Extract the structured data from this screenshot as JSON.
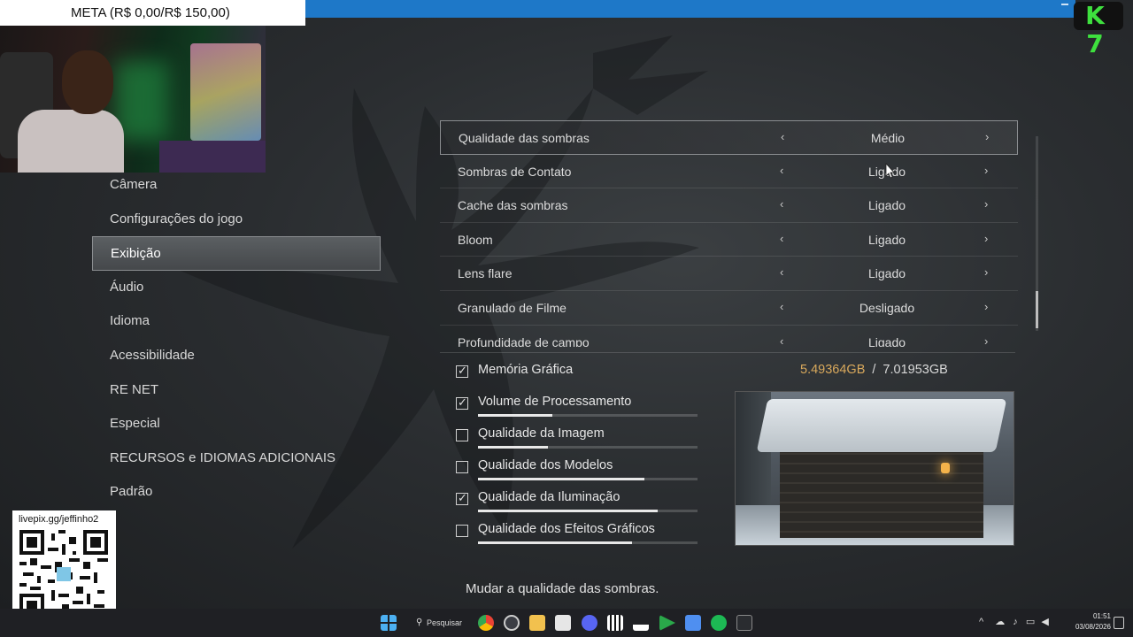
{
  "overlay": {
    "goal_banner": "META (R$ 0,00/R$ 150,00)",
    "qr_url": "livepix.gg/jeffinho2",
    "channel_logo": "K 7"
  },
  "menu": {
    "items": [
      {
        "label": "Câmera",
        "active": false
      },
      {
        "label": "Configurações do jogo",
        "active": false
      },
      {
        "label": "Exibição",
        "active": true
      },
      {
        "label": "Áudio",
        "active": false
      },
      {
        "label": "Idioma",
        "active": false
      },
      {
        "label": "Acessibilidade",
        "active": false
      },
      {
        "label": "RE NET",
        "active": false
      },
      {
        "label": "Especial",
        "active": false
      },
      {
        "label": "RECURSOS e IDIOMAS ADICIONAIS",
        "active": false
      },
      {
        "label": "Padrão",
        "active": false
      }
    ]
  },
  "settings": {
    "rows": [
      {
        "label": "Qualidade das sombras",
        "value": "Médio",
        "selected": true
      },
      {
        "label": "Sombras de Contato",
        "value": "Ligado",
        "selected": false
      },
      {
        "label": "Cache das sombras",
        "value": "Ligado",
        "selected": false
      },
      {
        "label": "Bloom",
        "value": "Ligado",
        "selected": false
      },
      {
        "label": "Lens flare",
        "value": "Ligado",
        "selected": false
      },
      {
        "label": "Granulado de Filme",
        "value": "Desligado",
        "selected": false
      },
      {
        "label": "Profundidade de campo",
        "value": "Ligado",
        "selected": false
      }
    ],
    "arrow_left": "‹",
    "arrow_right": "›"
  },
  "resources": {
    "memory_label": "Memória Gráfica",
    "memory_used": "5.49364GB",
    "memory_separator": "/",
    "memory_total": "7.01953GB",
    "items": [
      {
        "label": "Volume de Processamento",
        "checked": true,
        "level": 0.34
      },
      {
        "label": "Qualidade da Imagem",
        "checked": false,
        "level": 0.32
      },
      {
        "label": "Qualidade dos Modelos",
        "checked": false,
        "level": 0.76
      },
      {
        "label": "Qualidade da Iluminação",
        "checked": true,
        "level": 0.82
      },
      {
        "label": "Qualidade dos Efeitos Gráficos",
        "checked": false,
        "level": 0.7
      }
    ]
  },
  "hint": "Mudar a qualidade das sombras.",
  "taskbar": {
    "search_label": "Pesquisar",
    "time": "01:51",
    "date": "03/08/2026"
  }
}
